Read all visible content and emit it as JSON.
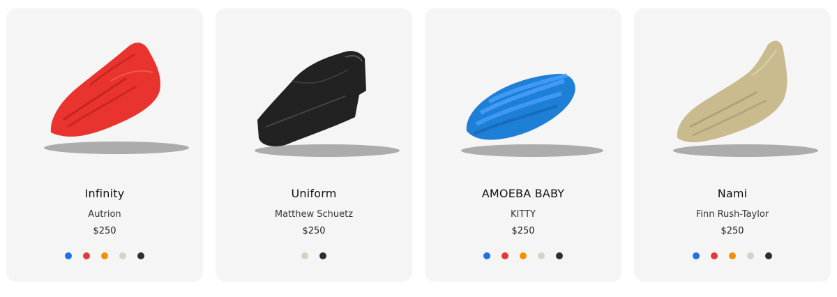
{
  "products": [
    {
      "title": "Infinity",
      "designer": "Autrion",
      "price": "$250",
      "shoe_color": "#e8332e",
      "swatches": [
        {
          "name": "blue",
          "color": "#1a73e8"
        },
        {
          "name": "red",
          "color": "#e53935"
        },
        {
          "name": "orange",
          "color": "#f39200"
        },
        {
          "name": "beige",
          "color": "#d8d2c2"
        },
        {
          "name": "black",
          "color": "#2e2e2e"
        }
      ]
    },
    {
      "title": "Uniform",
      "designer": "Matthew Schuetz",
      "price": "$250",
      "shoe_color": "#222222",
      "swatches": [
        {
          "name": "beige",
          "color": "#d8d2c2"
        },
        {
          "name": "black",
          "color": "#2e2e2e"
        }
      ]
    },
    {
      "title": "AMOEBA BABY",
      "designer": "KITTY",
      "price": "$250",
      "shoe_color": "#1e7fd6",
      "swatches": [
        {
          "name": "blue",
          "color": "#1a73e8"
        },
        {
          "name": "red",
          "color": "#e53935"
        },
        {
          "name": "orange",
          "color": "#f39200"
        },
        {
          "name": "beige",
          "color": "#d8d2c2"
        },
        {
          "name": "black",
          "color": "#2e2e2e"
        }
      ]
    },
    {
      "title": "Nami",
      "designer": "Finn Rush-Taylor",
      "price": "$250",
      "shoe_color": "#c9bb8e",
      "swatches": [
        {
          "name": "blue",
          "color": "#1a73e8"
        },
        {
          "name": "red",
          "color": "#e53935"
        },
        {
          "name": "orange",
          "color": "#f39200"
        },
        {
          "name": "beige",
          "color": "#d8d2c2"
        },
        {
          "name": "black",
          "color": "#2e2e2e"
        }
      ]
    }
  ]
}
